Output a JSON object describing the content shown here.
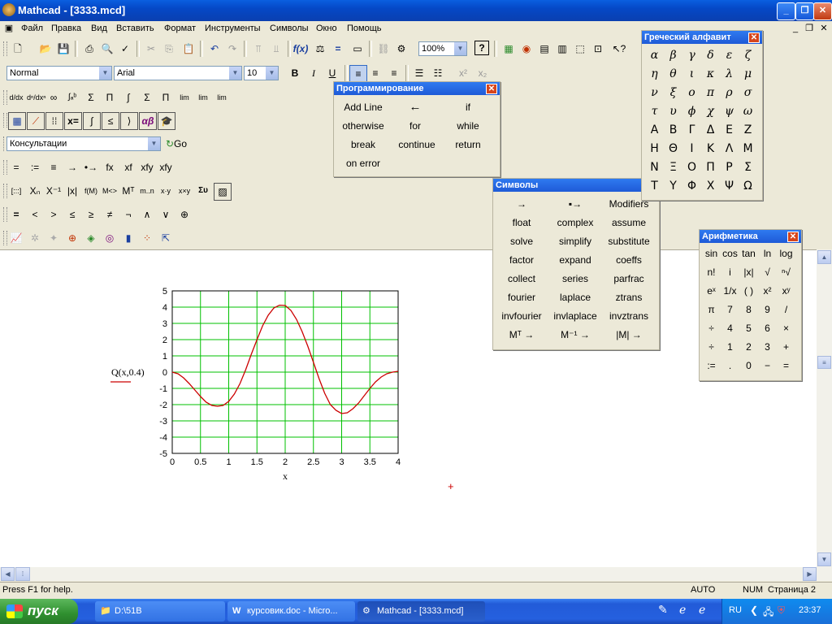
{
  "window": {
    "title": "Mathcad - [3333.mcd]",
    "min": "_",
    "max": "❐",
    "close": "✕"
  },
  "menu": [
    "Файл",
    "Правка",
    "Вид",
    "Вставить",
    "Формат",
    "Инструменты",
    "Символы",
    "Окно",
    "Помощь"
  ],
  "format_bar": {
    "style": "Normal",
    "font": "Arial",
    "size": "10",
    "bold": "B",
    "italic": "I",
    "underline": "U"
  },
  "zoom": "100%",
  "resources": {
    "value": "Консультации",
    "go": "Go"
  },
  "evaluation_toolbar": [
    "=",
    ":=",
    "≡",
    "→",
    "•→",
    "fx",
    "xf",
    "xfy",
    "xfy"
  ],
  "boolean_toolbar": [
    "=",
    "<",
    ">",
    "≤",
    "≥",
    "≠",
    "¬",
    "∧",
    "∨",
    "⊕"
  ],
  "calculus_toolbar": [
    "d/dx",
    "dⁿ/dxⁿ",
    "∞",
    "∫ₐᵇ",
    "Σ",
    "Π",
    "∫",
    "Σ",
    "Π",
    "lim",
    "lim",
    "lim"
  ],
  "matrix_toolbar": [
    "[:::]",
    "Xₙ",
    "X⁻¹",
    "|x|",
    "f(M)",
    "M<>",
    "Mᵀ",
    "m..n",
    "x·y",
    "x×y",
    "Συ"
  ],
  "programming": {
    "title": "Программирование",
    "items": [
      "Add Line",
      "←",
      "if",
      "otherwise",
      "for",
      "while",
      "break",
      "continue",
      "return",
      "on error"
    ]
  },
  "symbols": {
    "title": "Символы",
    "items": [
      "→",
      "▪→",
      "Modifiers",
      "float",
      "complex",
      "assume",
      "solve",
      "simplify",
      "substitute",
      "factor",
      "expand",
      "coeffs",
      "collect",
      "series",
      "parfrac",
      "fourier",
      "laplace",
      "ztrans",
      "invfourier",
      "invlaplace",
      "invztrans",
      "Mᵀ →",
      "M⁻¹ →",
      "|M| →"
    ]
  },
  "greek": {
    "title": "Греческий алфавит",
    "lower": [
      "α",
      "β",
      "γ",
      "δ",
      "ε",
      "ζ",
      "η",
      "θ",
      "ι",
      "κ",
      "λ",
      "μ",
      "ν",
      "ξ",
      "ο",
      "π",
      "ρ",
      "σ",
      "τ",
      "υ",
      "ϕ",
      "χ",
      "ψ",
      "ω"
    ],
    "upper": [
      "Α",
      "Β",
      "Γ",
      "Δ",
      "Ε",
      "Ζ",
      "Η",
      "Θ",
      "Ι",
      "Κ",
      "Λ",
      "Μ",
      "Ν",
      "Ξ",
      "Ο",
      "Π",
      "Ρ",
      "Σ",
      "Τ",
      "Υ",
      "Φ",
      "Χ",
      "Ψ",
      "Ω"
    ]
  },
  "arithmetic": {
    "title": "Арифметика",
    "items": [
      "sin",
      "cos",
      "tan",
      "ln",
      "log",
      "n!",
      "i",
      "|x|",
      "√",
      "ⁿ√",
      "eˣ",
      "1/x",
      "( )",
      "x²",
      "xʸ",
      "π",
      "7",
      "8",
      "9",
      "/",
      "÷",
      "4",
      "5",
      "6",
      "×",
      "÷",
      "1",
      "2",
      "3",
      "+",
      ":=",
      ".",
      "0",
      "−",
      "="
    ]
  },
  "chart_data": {
    "type": "line",
    "ylabel": "Q(x,0.4)",
    "xlabel": "x",
    "xlim": [
      0,
      4
    ],
    "ylim": [
      -5,
      5
    ],
    "xticks": [
      "0",
      "0.5",
      "1",
      "1.5",
      "2",
      "2.5",
      "3",
      "3.5",
      "4"
    ],
    "yticks": [
      "5",
      "4",
      "3",
      "2",
      "1",
      "0",
      "-1",
      "-2",
      "-3",
      "-4",
      "-5"
    ],
    "grid": true,
    "line_color": "#cc0000",
    "grid_color": "#00c000",
    "series": [
      {
        "x": [
          0,
          0.1,
          0.2,
          0.3,
          0.4,
          0.5,
          0.6,
          0.7,
          0.8,
          0.9,
          1.0,
          1.1,
          1.2,
          1.3,
          1.4,
          1.5,
          1.6,
          1.7,
          1.8,
          1.9,
          2.0,
          2.1,
          2.2,
          2.3,
          2.4,
          2.5,
          2.6,
          2.7,
          2.8,
          2.9,
          3.0,
          3.1,
          3.2,
          3.3,
          3.4,
          3.5,
          3.6,
          3.7,
          3.8,
          3.9,
          4.0
        ],
        "values": [
          0,
          -0.1,
          -0.35,
          -0.7,
          -1.1,
          -1.5,
          -1.85,
          -2.05,
          -2.1,
          -2.05,
          -1.8,
          -1.35,
          -0.7,
          0.15,
          1.1,
          2.0,
          2.85,
          3.5,
          3.95,
          4.12,
          4.1,
          3.8,
          3.25,
          2.5,
          1.6,
          0.6,
          -0.4,
          -1.3,
          -2.0,
          -2.35,
          -2.55,
          -2.5,
          -2.25,
          -1.9,
          -1.45,
          -1.0,
          -0.6,
          -0.3,
          -0.1,
          0,
          0.05
        ]
      }
    ]
  },
  "status": {
    "help": "Press F1 for help.",
    "auto": "AUTO",
    "num": "NUM",
    "page": "Страница 2"
  },
  "taskbar": {
    "start": "пуск",
    "buttons": [
      "D:\\51B",
      "курсовик.doc - Micro...",
      "Mathcad - [3333.mcd]"
    ],
    "lang": "RU",
    "clock": "23:37"
  }
}
